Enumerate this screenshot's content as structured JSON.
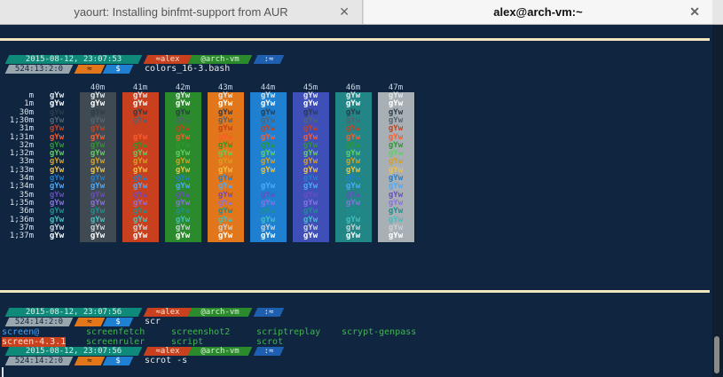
{
  "tabs": [
    {
      "title": "yaourt: Installing binfmt-support from AUR",
      "active": false
    },
    {
      "title": "alex@arch-vm:~",
      "active": true
    }
  ],
  "prompts": [
    {
      "date": "2015-08-12, 23:07:53",
      "user": "≈alex",
      "host": "@arch-vm",
      "dir": ":≈",
      "jobs": "524:13:2:0",
      "git": "≈",
      "sigil": "$",
      "command": "colors_16-3.bash"
    },
    {
      "date": "2015-08-12, 23:07:56",
      "user": "≈alex",
      "host": "@arch-vm",
      "dir": ":≈",
      "jobs": "524:14:2:0",
      "git": "≈",
      "sigil": "$",
      "command": "scr"
    },
    {
      "date": "2015-08-12, 23:07:56",
      "user": "≈alex",
      "host": "@arch-vm",
      "dir": ":≈",
      "jobs": "524:14:2:0",
      "git": "≈",
      "sigil": "$",
      "command": "scrot -s"
    }
  ],
  "color_table": {
    "sample": "gYw",
    "columns": [
      "",
      "40m",
      "41m",
      "42m",
      "43m",
      "44m",
      "45m",
      "46m",
      "47m"
    ],
    "column_bg": [
      "#0f2540",
      "#404a52",
      "#c8401e",
      "#2b8a2b",
      "#e2761a",
      "#1f7fd0",
      "#3f4fb8",
      "#238686",
      "#a8b0b6"
    ],
    "rows": [
      "m",
      "1m",
      "30m",
      "1;30m",
      "31m",
      "1;31m",
      "32m",
      "1;32m",
      "33m",
      "1;33m",
      "34m",
      "1;34m",
      "35m",
      "1;35m",
      "36m",
      "1;36m",
      "37m",
      "1;37m"
    ],
    "row_fg": [
      "#dfe6ea",
      "#ffffff",
      "#2e3d4a",
      "#54646e",
      "#c8401e",
      "#ff5a2a",
      "#2b9a2b",
      "#5ed05e",
      "#d6a020",
      "#f0c040",
      "#1f7fd0",
      "#4aaaff",
      "#6a4cc0",
      "#8a70e0",
      "#1d8f8f",
      "#40c0c0",
      "#c8d0d6",
      "#ffffff"
    ]
  },
  "completions": {
    "row1": [
      "screen@",
      "screenfetch",
      "screenshot2",
      "scriptreplay",
      "scrypt-genpass"
    ],
    "row2": [
      "screen-4.3.1",
      "screenruler",
      "script",
      "scrot"
    ]
  },
  "colors": {
    "date_bg": "#0f8a7a",
    "user_bg": "#c8401e",
    "host_bg": "#2b8a2b",
    "dir_bg": "#1f5fb0",
    "jobs_bg": "#9aa6ae",
    "git_bg": "#e2761a",
    "sigil_bg": "#1f7fd0",
    "rule": "#f2e6bf"
  }
}
